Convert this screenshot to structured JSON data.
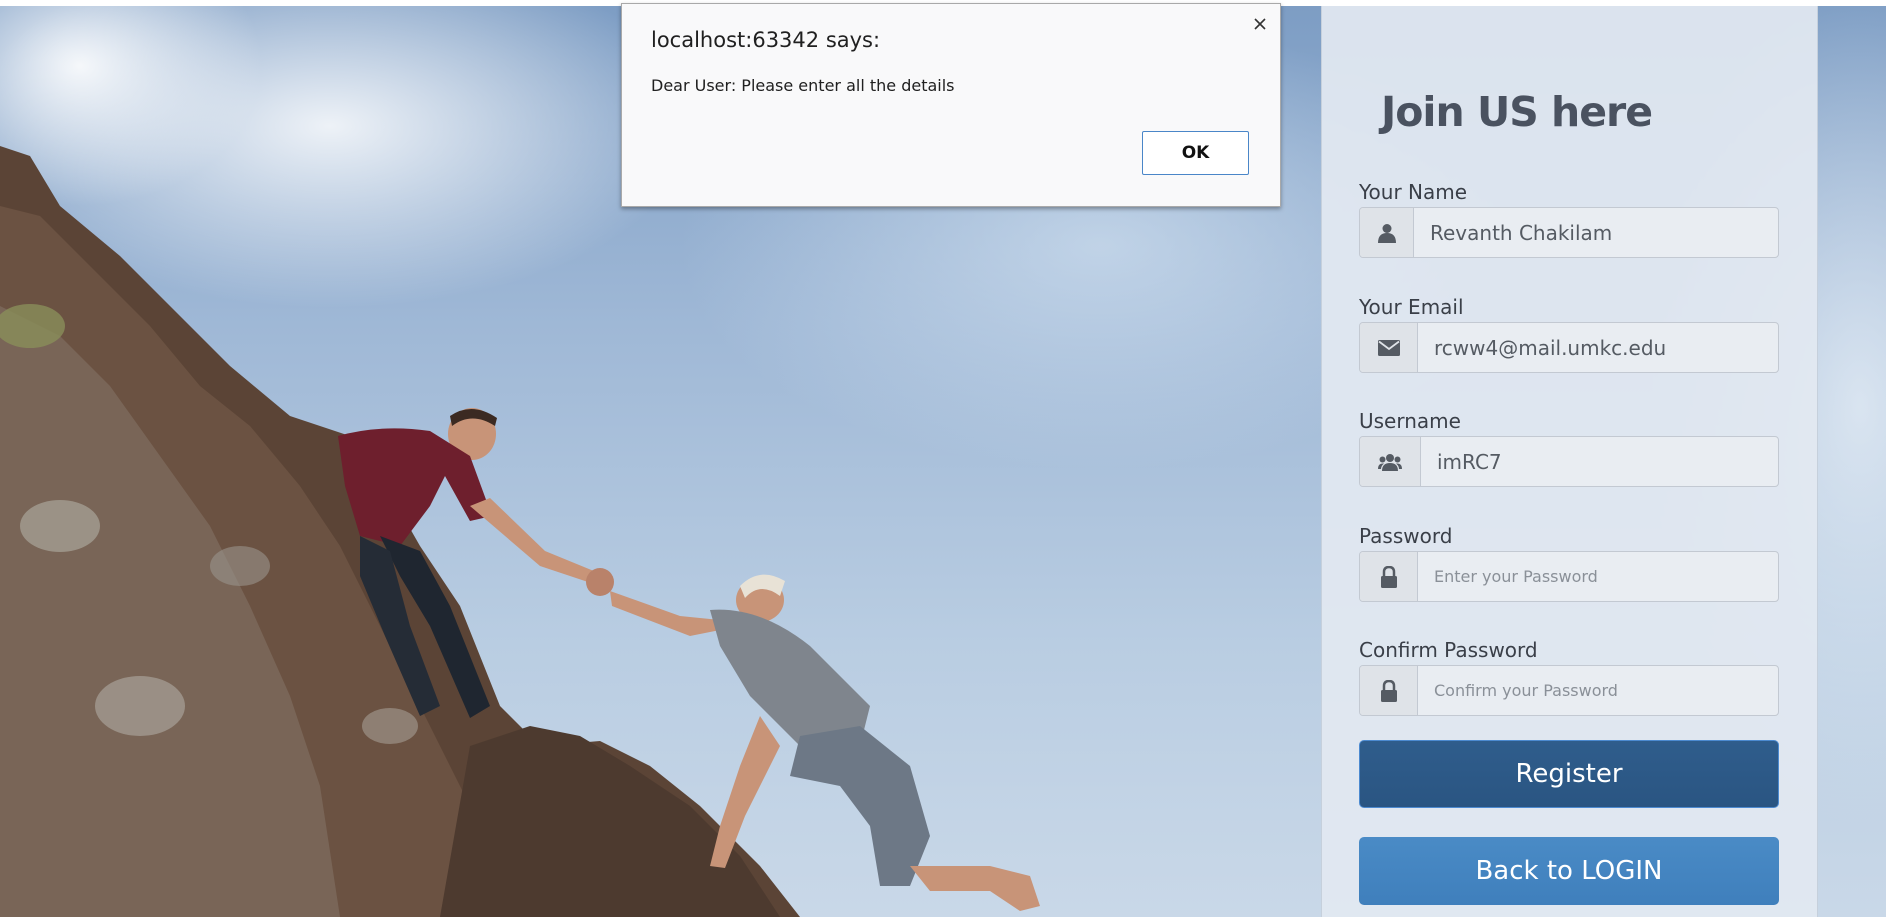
{
  "dialog": {
    "title": "localhost:63342 says:",
    "message": "Dear User: Please enter all the details",
    "ok_label": "OK",
    "close_icon": "close-icon"
  },
  "form": {
    "title": "Join US here",
    "name": {
      "label": "Your Name",
      "value": "Revanth Chakilam",
      "icon": "user-icon"
    },
    "email": {
      "label": "Your Email",
      "value": "rcww4@mail.umkc.edu",
      "icon": "envelope-icon"
    },
    "username": {
      "label": "Username",
      "value": "imRC7",
      "icon": "users-icon"
    },
    "password": {
      "label": "Password",
      "placeholder": "Enter your Password",
      "icon": "lock-icon"
    },
    "confirm_password": {
      "label": "Confirm Password",
      "placeholder": "Confirm your Password",
      "icon": "lock-icon"
    },
    "register_label": "Register",
    "back_label": "Back to LOGIN"
  },
  "colors": {
    "register_button": "#2f5d8c",
    "login_button": "#4a8bc6",
    "panel_background": "#e2e8f1",
    "title_text": "#4a5260"
  },
  "background": {
    "image_subject": "two climbers on a rocky cliff reaching hands against a cloudy blue sky"
  }
}
